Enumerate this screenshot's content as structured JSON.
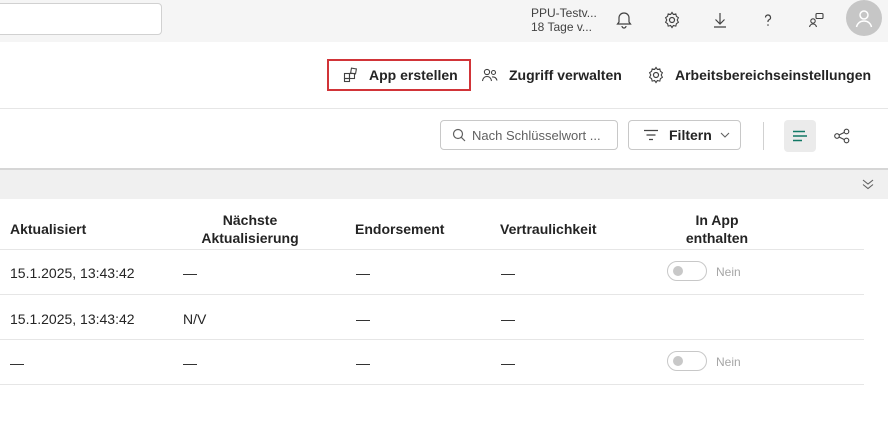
{
  "topbar": {
    "license_line1": "PPU-Testv...",
    "license_line2": "18 Tage v...",
    "icons": [
      "bell-icon",
      "gear-icon",
      "download-icon",
      "help-icon",
      "feedback-icon",
      "user-avatar-icon"
    ]
  },
  "actions": {
    "create_app": "App erstellen",
    "manage_access": "Zugriff verwalten",
    "workspace_settings": "Arbeitsbereichseinstellungen"
  },
  "filterbar": {
    "search_placeholder": "Nach Schlüsselwort ...",
    "filter_label": "Filtern"
  },
  "table": {
    "headers": {
      "updated": "Aktualisiert",
      "next_update_1": "Nächste",
      "next_update_2": "Aktualisierung",
      "endorsement": "Endorsement",
      "sensitivity": "Vertraulichkeit",
      "in_app_1": "In App",
      "in_app_2": "enthalten"
    },
    "rows": [
      {
        "updated": "15.1.2025, 13:43:42",
        "next": "—",
        "endorsement": "—",
        "sensitivity": "—",
        "toggle_label": "Nein"
      },
      {
        "updated": "15.1.2025, 13:43:42",
        "next": "N/V",
        "endorsement": "—",
        "sensitivity": "—",
        "toggle_label": ""
      },
      {
        "updated": "—",
        "next": "—",
        "endorsement": "—",
        "sensitivity": "—",
        "toggle_label": "Nein"
      }
    ]
  },
  "colors": {
    "highlight_border": "#d13438",
    "accent_green": "#117865"
  }
}
